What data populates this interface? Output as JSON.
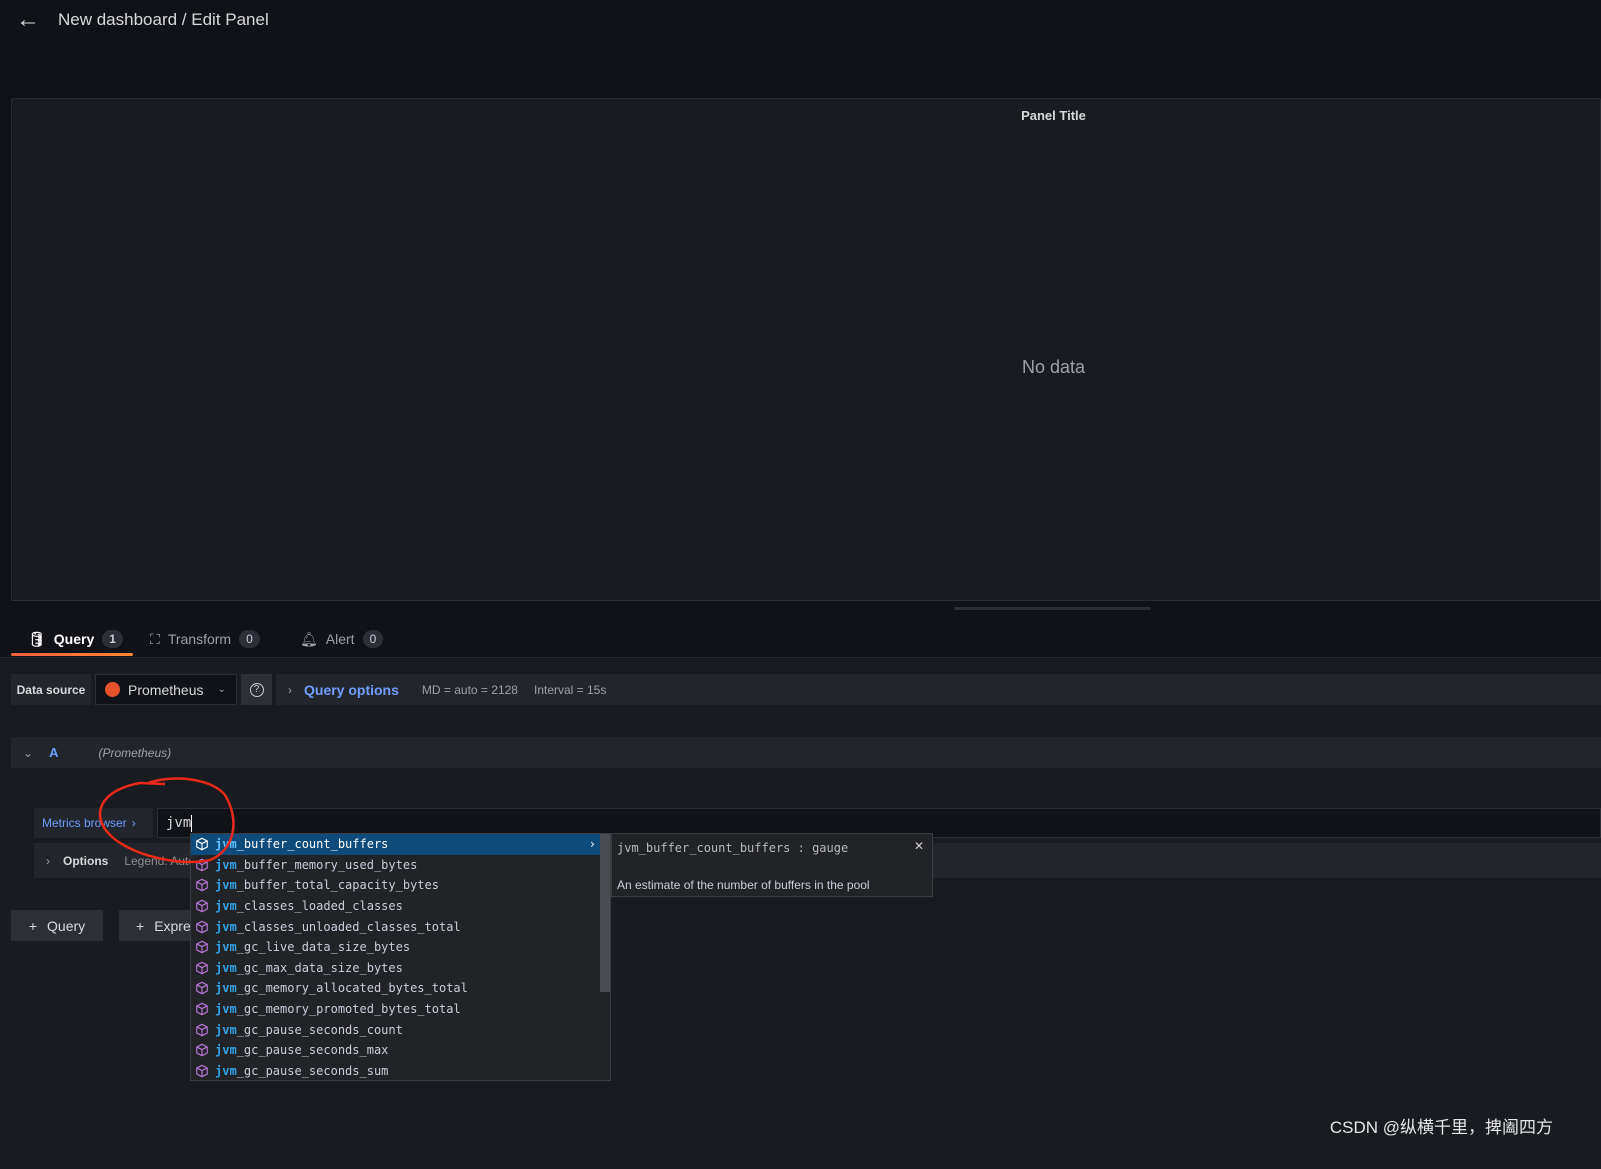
{
  "header": {
    "title": "New dashboard / Edit Panel",
    "back_icon": "arrow-left-icon"
  },
  "panel": {
    "title": "Panel Title",
    "empty_text": "No data"
  },
  "tabs": [
    {
      "label": "Query",
      "count": "1"
    },
    {
      "label": "Transform",
      "count": "0"
    },
    {
      "label": "Alert",
      "count": "0"
    }
  ],
  "datasource": {
    "label": "Data source",
    "value": "Prometheus",
    "query_options": "Query options",
    "md": "MD = auto = 2128",
    "interval": "Interval = 15s"
  },
  "query": {
    "ref": "A",
    "ds": "(Prometheus)",
    "metrics_browser": "Metrics browser",
    "input_value": "jvm",
    "options_label": "Options",
    "options_summary": "Legend: Auto"
  },
  "buttons": {
    "add_query": "Query",
    "add_expression": "Expression"
  },
  "suggestions": {
    "match": "jvm",
    "items": [
      "_buffer_count_buffers",
      "_buffer_memory_used_bytes",
      "_buffer_total_capacity_bytes",
      "_classes_loaded_classes",
      "_classes_unloaded_classes_total",
      "_gc_live_data_size_bytes",
      "_gc_max_data_size_bytes",
      "_gc_memory_allocated_bytes_total",
      "_gc_memory_promoted_bytes_total",
      "_gc_pause_seconds_count",
      "_gc_pause_seconds_max",
      "_gc_pause_seconds_sum"
    ]
  },
  "doc": {
    "signature": "jvm_buffer_count_buffers : gauge",
    "description": "An estimate of the number of buffers in the pool"
  },
  "watermark": "CSDN @纵横千里，捭阖四方",
  "colors": {
    "accent": "#6e9fff",
    "selected": "#0e4a7a",
    "match": "#33a2e5",
    "annotation": "#e8291c"
  }
}
